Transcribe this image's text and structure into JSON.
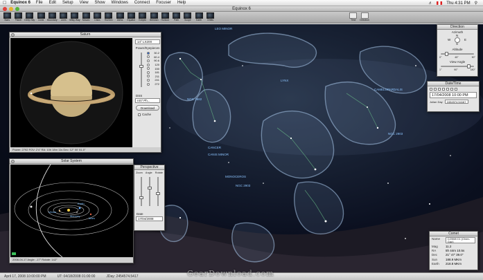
{
  "menubar": {
    "app_name": "Equinox 6",
    "items": [
      "File",
      "Edit",
      "Setup",
      "View",
      "Show",
      "Windows",
      "Connect",
      "Focuser",
      "Help"
    ],
    "clock": "Thu 4:31 PM"
  },
  "window": {
    "title": "Equinox 6"
  },
  "toolbar": {
    "tools": [
      "Stars",
      "Planet",
      "Deep Sky",
      "Const",
      "Boundary",
      "Lines",
      "Milky Way",
      "Mosaic",
      "Disks",
      "RA/Dec",
      "Alt/Az",
      "Equator",
      "Ecliptic",
      "Meridian",
      "Horizon",
      "Path",
      "Scope",
      "Earth",
      "Orbits"
    ],
    "right_tools": [
      "Time",
      "Direction"
    ]
  },
  "sky": {
    "labels": [
      "CANCER",
      "LEO MINOR",
      "NGC 2682",
      "LYNX",
      "NGC 2903",
      "MONOCEROS",
      "CANIS MINOR",
      "CAMELOPARDALIS",
      "NGC 2903"
    ]
  },
  "saturn": {
    "title": "Saturn",
    "fov_select": "14° LX200",
    "section_title": "Power/Eyepieces",
    "powers": [
      "30.2",
      "60.4",
      "90.6",
      "120",
      "150",
      "181",
      "211",
      "241",
      "272"
    ],
    "dss_label": "DSS",
    "dss_select": "nS7 Ph...",
    "download_button": "Download",
    "cache_label": "Cache",
    "status": "Power: 2792   FOV: 2'4\"   RA: 10h 18m 11s  Dec: 12° 00' 51.0\""
  },
  "solar": {
    "title": "Solar System",
    "planets": [
      "Venus",
      "Earth",
      "Mercury",
      "Mars"
    ],
    "status": "2008-04-17    Angle: -17°  Rotate: 142°"
  },
  "perspective": {
    "title": "Perspective",
    "sliders": [
      "Zoom",
      "Angle",
      "Rotate"
    ],
    "date_label": "Date",
    "date_select": "17/04/2008"
  },
  "direction": {
    "title": "Direction",
    "azimuth_label": "Azimuth",
    "compass": [
      "N",
      "E",
      "S",
      "W"
    ],
    "altitude_label": "Altitude",
    "alt_ticks": [
      "0°",
      "45°",
      "90°"
    ],
    "view_angle_label": "View Angle",
    "view_ticks": [
      "1°",
      "90°",
      "180°"
    ]
  },
  "datetime": {
    "title": "Date/Time",
    "value": "17/04/2008 10:00 PM",
    "julian_label": "Julian Day",
    "julian_value": "2454574.54167"
  },
  "comet": {
    "title": "Comet",
    "rows": [
      {
        "k": "Name",
        "v": "C/2008 C1 (Chen-Gao)"
      },
      {
        "k": "Mag",
        "v": "11.2"
      },
      {
        "k": "RA",
        "v": "5h 44m 10.5s"
      },
      {
        "k": "Dec",
        "v": "21° 47' 39.0\""
      },
      {
        "k": "Sun",
        "v": "188.9 MKm"
      },
      {
        "k": "Earth",
        "v": "218.8 MKm"
      }
    ]
  },
  "statusbar": {
    "date": "April 17, 2008 10:00:00 PM",
    "ut": "UT: 04/18/2008 01:00:00",
    "jd": "JDay: 2454574.5417"
  },
  "watermark": "GearDownload.com"
}
